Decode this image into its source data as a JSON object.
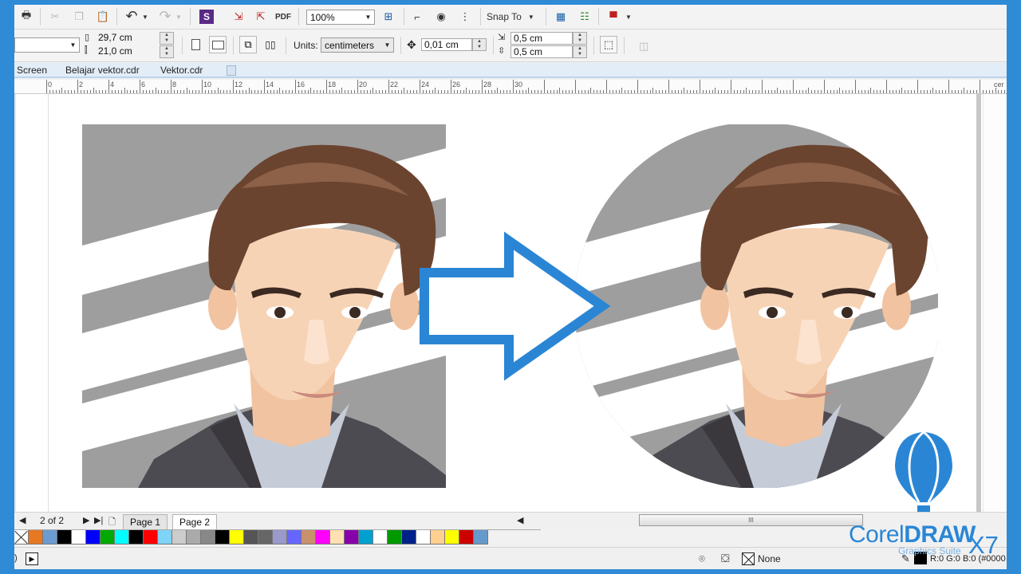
{
  "window": {
    "accent": "#2f8bd6"
  },
  "standard_toolbar": {
    "zoom_value": "100%",
    "snap_to_label": "Snap To",
    "icons": [
      "print-icon",
      "cut-icon",
      "copy-icon",
      "paste-icon",
      "undo-icon",
      "redo-icon",
      "launch-icon",
      "import-icon",
      "export-icon",
      "publish-pdf-icon",
      "full-screen-icon",
      "show-rulers-icon",
      "view-icon",
      "grid-icon",
      "options-icon",
      "application-launcher-icon",
      "color-proof-icon"
    ]
  },
  "property_bar": {
    "paper_size_value": "",
    "page_width": "29,7 cm",
    "page_height": "21,0 cm",
    "units_label": "Units:",
    "units_value": "centimeters",
    "nudge_distance": "0,01 cm",
    "duplicate_x": "0,5 cm",
    "duplicate_y": "0,5 cm"
  },
  "document_tabs": [
    {
      "label": "Screen",
      "active": false
    },
    {
      "label": "Belajar vektor.cdr",
      "active": false
    },
    {
      "label": "Vektor.cdr",
      "active": true
    }
  ],
  "ruler": {
    "labels": [
      "0",
      "2",
      "4",
      "6",
      "8",
      "10",
      "12",
      "14",
      "16",
      "18",
      "20",
      "22",
      "24",
      "26",
      "28",
      "30"
    ],
    "unit_label": "cer"
  },
  "canvas": {
    "images": [
      {
        "name": "square-portrait",
        "shape": "square"
      },
      {
        "name": "circle-portrait",
        "shape": "circle"
      }
    ],
    "arrow_color": "#2a86d5"
  },
  "page_navigator": {
    "position": "2 of 2",
    "pages": [
      {
        "label": "Page 1",
        "active": false
      },
      {
        "label": "Page 2",
        "active": true
      }
    ],
    "scroll_grip": "III"
  },
  "palette": {
    "colors": [
      "#e87722",
      "#6c9bd2",
      "#000000",
      "#ffffff",
      "#0000ff",
      "#00aa00",
      "#00ffff",
      "#000000",
      "#ff0000",
      "#7fd3f5",
      "#cccccc",
      "#aaaaaa",
      "#888888",
      "#000000",
      "#ffff00",
      "#555555",
      "#666666",
      "#9999cc",
      "#6666ff",
      "#c8906c",
      "#ff00ff",
      "#ffe0b0",
      "#8800aa",
      "#00a0d0",
      "#ffffff",
      "#009900",
      "#002288",
      "#ffffff",
      "#ffd090",
      "#ffff00",
      "#cc0000",
      "#6699cc"
    ]
  },
  "status_bar": {
    "fill_none_label": "None",
    "color_readout": "R:0 G:0 B:0 (#0000"
  },
  "branding": {
    "title_regular": "Corel",
    "title_bold": "DRAW",
    "version": "X7",
    "subtitle": "Graphics Suite"
  }
}
